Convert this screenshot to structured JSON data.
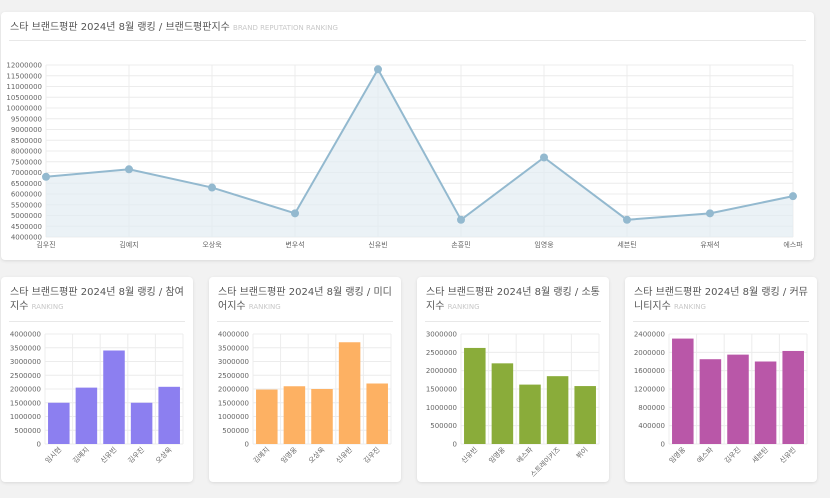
{
  "colors": {
    "line": "#93b9cf",
    "line_fill": "#e3edf2",
    "purple": "#8c7ff0",
    "orange": "#fdb163",
    "green": "#8aac3a",
    "magenta": "#b957a8",
    "grid": "#ececec"
  },
  "panels": [
    {
      "id": "main",
      "title": "스타 브랜드평판 2024년 8월 랭킹 / 브랜드평판지수",
      "subtitle": "BRAND REPUTATION RANKING"
    },
    {
      "id": "participation",
      "title_lines": [
        "스타 브랜드평판 2024년 8월 랭킹 / 참여",
        "지수"
      ],
      "subtitle": "RANKING"
    },
    {
      "id": "media",
      "title_lines": [
        "스타 브랜드평판 2024년 8월 랭킹 / 미디",
        "어지수"
      ],
      "subtitle": "RANKING"
    },
    {
      "id": "communication",
      "title_lines": [
        "스타 브랜드평판 2024년 8월 랭킹 / 소통",
        "지수"
      ],
      "subtitle": "RANKING"
    },
    {
      "id": "community",
      "title_lines": [
        "스타 브랜드평판 2024년 8월 랭킹 / 커뮤",
        "니티지수"
      ],
      "subtitle": "RANKING"
    }
  ],
  "chart_data": [
    {
      "type": "area",
      "categories": [
        "김우진",
        "김예지",
        "오상욱",
        "변우석",
        "신유빈",
        "손흥민",
        "임영웅",
        "세븐틴",
        "유재석",
        "에스파"
      ],
      "values": [
        6800000,
        7150000,
        6300000,
        5100000,
        11800000,
        4800000,
        7700000,
        4800000,
        5100000,
        5900000
      ],
      "ylim": [
        4000000,
        12000000
      ],
      "yticks": [
        4000000,
        4500000,
        5000000,
        5500000,
        6000000,
        6500000,
        7000000,
        7500000,
        8000000,
        8500000,
        9000000,
        9500000,
        10000000,
        10500000,
        11000000,
        11500000,
        12000000
      ],
      "grid": true
    },
    {
      "type": "bar",
      "categories": [
        "임시현",
        "김예지",
        "신유빈",
        "김우진",
        "오상욱"
      ],
      "values": [
        1500000,
        2050000,
        3400000,
        1500000,
        2080000
      ],
      "ylim": [
        0,
        4000000
      ],
      "yticks": [
        0,
        500000,
        1000000,
        1500000,
        2000000,
        2500000,
        3000000,
        3500000,
        4000000
      ],
      "color": "#8c7ff0"
    },
    {
      "type": "bar",
      "categories": [
        "김예지",
        "임영웅",
        "오상욱",
        "신유빈",
        "김우진"
      ],
      "values": [
        1980000,
        2100000,
        2000000,
        3700000,
        2200000
      ],
      "ylim": [
        0,
        4000000
      ],
      "yticks": [
        0,
        500000,
        1000000,
        1500000,
        2000000,
        2500000,
        3000000,
        3500000,
        4000000
      ],
      "color": "#fdb163"
    },
    {
      "type": "bar",
      "categories": [
        "신유빈",
        "임영웅",
        "에스파",
        "스트레이키즈",
        "뷔이"
      ],
      "values": [
        2620000,
        2200000,
        1620000,
        1850000,
        1580000
      ],
      "ylim": [
        0,
        3000000
      ],
      "yticks": [
        0,
        500000,
        1000000,
        1500000,
        2000000,
        2500000,
        3000000
      ],
      "color": "#8aac3a"
    },
    {
      "type": "bar",
      "categories": [
        "임영웅",
        "에스파",
        "김우진",
        "세븐틴",
        "신유빈"
      ],
      "values": [
        2300000,
        1850000,
        1950000,
        1800000,
        2030000
      ],
      "ylim": [
        0,
        2400000
      ],
      "yticks": [
        0,
        400000,
        800000,
        1200000,
        1600000,
        2000000,
        2400000
      ],
      "color": "#b957a8"
    }
  ]
}
